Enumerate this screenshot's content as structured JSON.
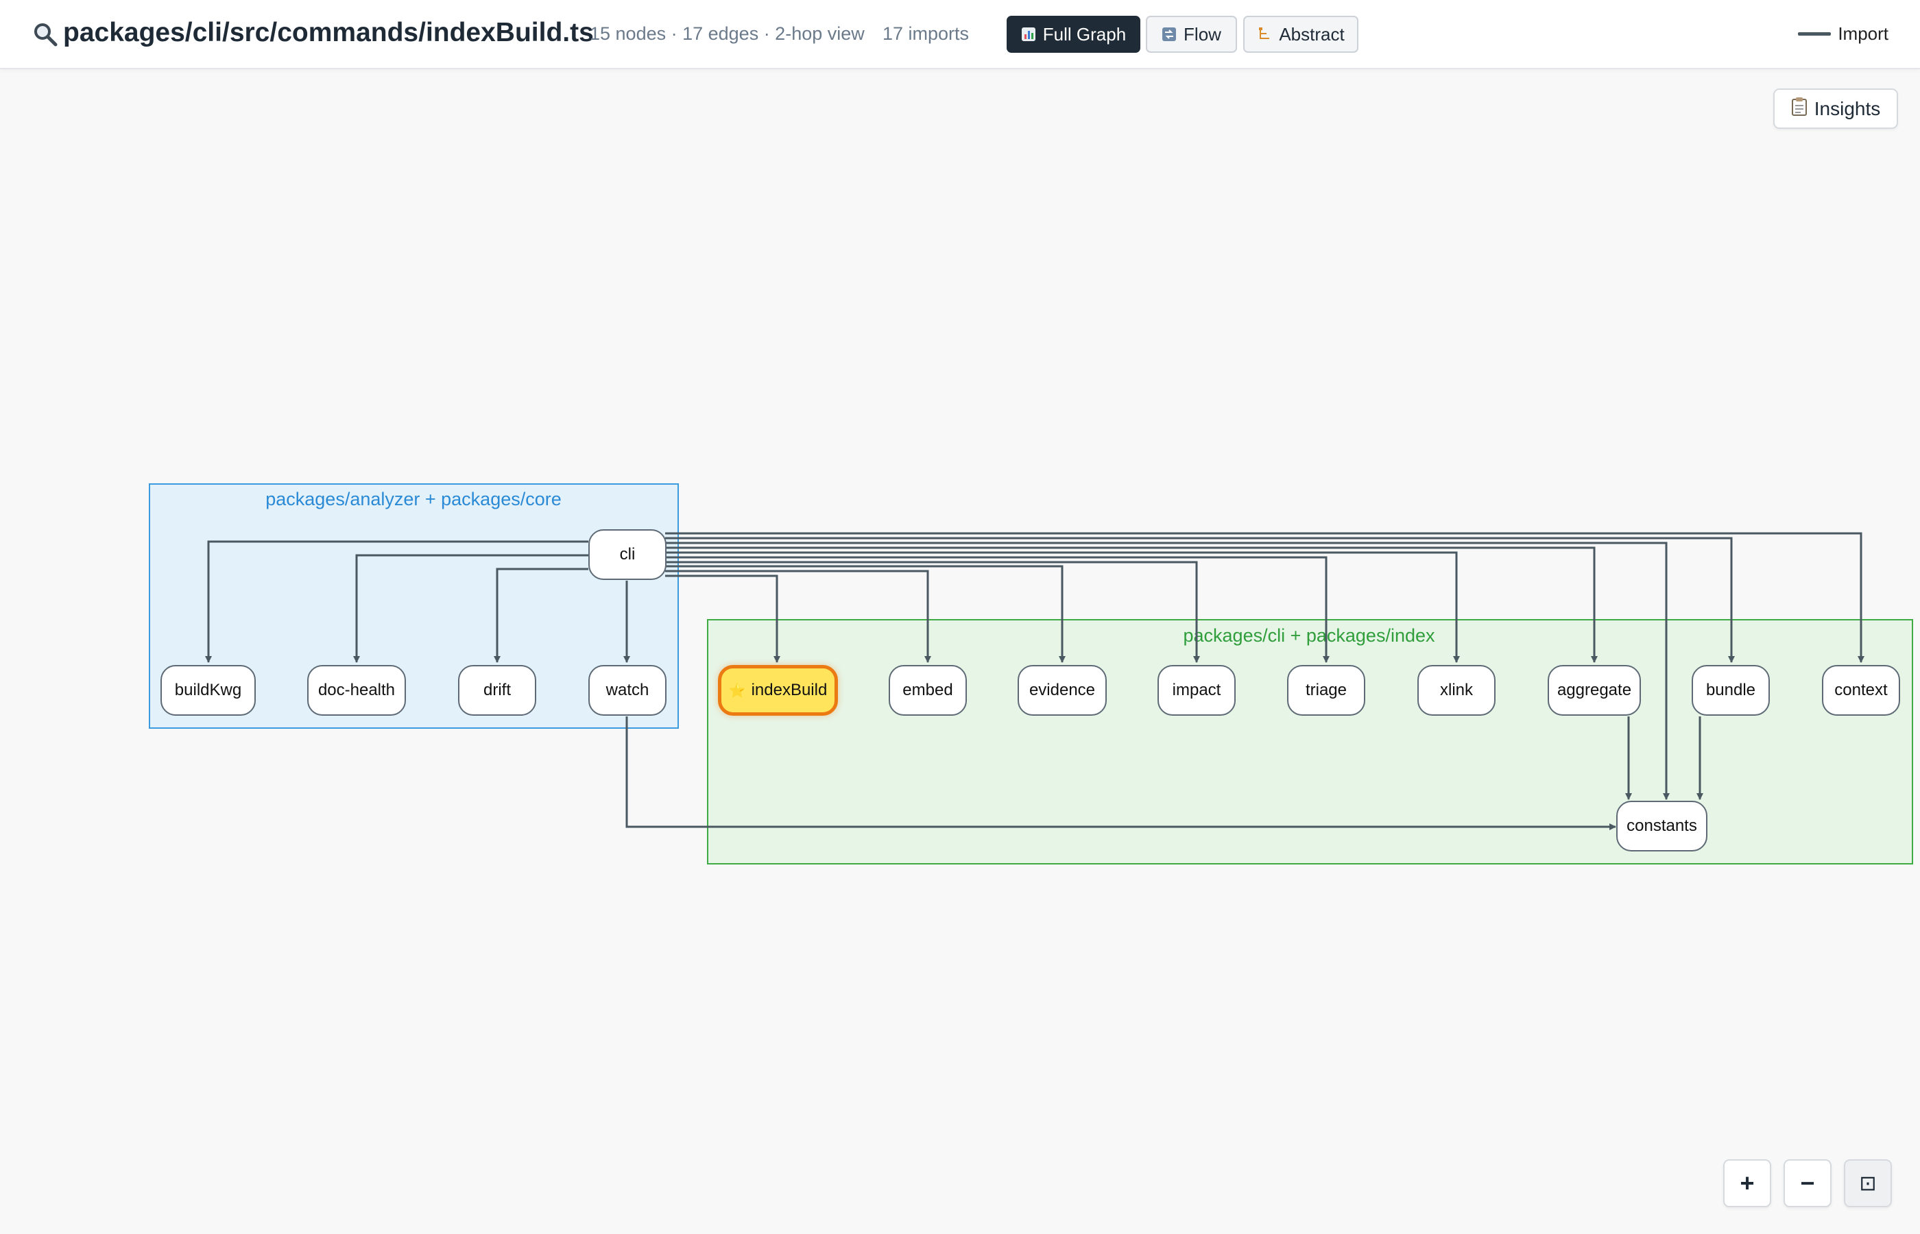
{
  "header": {
    "title": "packages/cli/src/commands/indexBuild.ts",
    "stats": "15 nodes · 17 edges · 2-hop view",
    "imports": "17 imports",
    "modes": [
      {
        "label": "Full Graph",
        "icon": "bar-chart-icon",
        "active": true
      },
      {
        "label": "Flow",
        "icon": "flow-icon",
        "active": false
      },
      {
        "label": "Abstract",
        "icon": "tree-icon",
        "active": false
      }
    ],
    "legend": {
      "label": "Import",
      "color": "#4a5862"
    }
  },
  "canvas": {
    "insights_label": "Insights",
    "groups": [
      {
        "label": "packages/analyzer + packages/core",
        "color": "#3c9ade"
      },
      {
        "label": "packages/cli + packages/index",
        "color": "#3fab45"
      }
    ],
    "nodes": {
      "cli": "cli",
      "buildKwg": "buildKwg",
      "doc_health": "doc-health",
      "drift": "drift",
      "watch": "watch",
      "indexBuild": "indexBuild",
      "embed": "embed",
      "evidence": "evidence",
      "impact": "impact",
      "triage": "triage",
      "xlink": "xlink",
      "aggregate": "aggregate",
      "bundle": "bundle",
      "context": "context",
      "constants": "constants"
    },
    "focus_node": "indexBuild",
    "edges": [
      [
        "cli",
        "buildKwg"
      ],
      [
        "cli",
        "doc_health"
      ],
      [
        "cli",
        "drift"
      ],
      [
        "cli",
        "watch"
      ],
      [
        "cli",
        "indexBuild"
      ],
      [
        "cli",
        "embed"
      ],
      [
        "cli",
        "evidence"
      ],
      [
        "cli",
        "impact"
      ],
      [
        "cli",
        "triage"
      ],
      [
        "cli",
        "xlink"
      ],
      [
        "cli",
        "aggregate"
      ],
      [
        "cli",
        "bundle"
      ],
      [
        "cli",
        "context"
      ],
      [
        "cli",
        "constants"
      ],
      [
        "watch",
        "constants"
      ],
      [
        "aggregate",
        "constants"
      ],
      [
        "bundle",
        "constants"
      ]
    ]
  },
  "zoom": {
    "in": "+",
    "out": "−",
    "fit": "⊡"
  }
}
